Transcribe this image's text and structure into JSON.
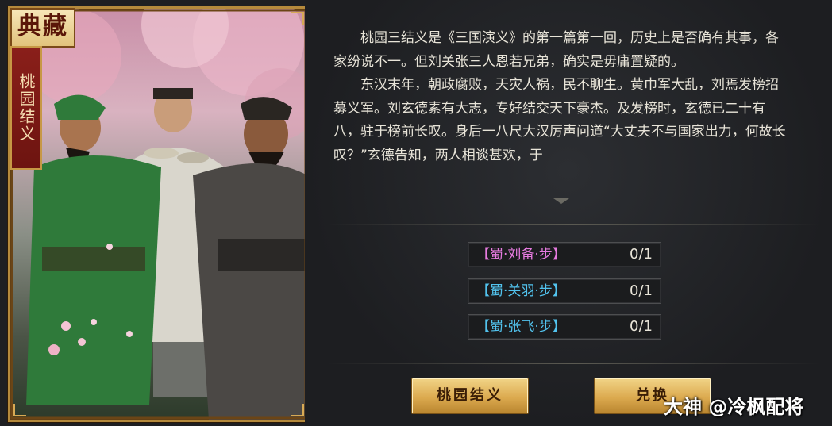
{
  "card": {
    "badge": "典藏",
    "vertical_title": "桃园结义"
  },
  "story": {
    "paragraphs": [
      "桃园三结义是《三国演义》的第一篇第一回，历史上是否确有其事，各家纷说不一。但刘关张三人恩若兄弟，确实是毋庸置疑的。",
      "东汉末年，朝政腐败，天灾人祸，民不聊生。黄巾军大乱，刘焉发榜招募义军。刘玄德素有大志，专好结交天下豪杰。及发榜时，玄德已二十有八，驻于榜前长叹。身后一八尺大汉厉声问道“大丈夫不与国家出力，何故长叹？”玄德告知，两人相谈甚欢，于"
    ]
  },
  "requirements": [
    {
      "name": "【蜀·刘备·步】",
      "count": "0/1",
      "color": "#e77be0"
    },
    {
      "name": "【蜀·关羽·步】",
      "count": "0/1",
      "color": "#52c3ee"
    },
    {
      "name": "【蜀·张飞·步】",
      "count": "0/1",
      "color": "#52c3ee"
    }
  ],
  "buttons": {
    "left": "桃园结义",
    "right": "兑换"
  },
  "watermark": "大神 @冷枫配将"
}
